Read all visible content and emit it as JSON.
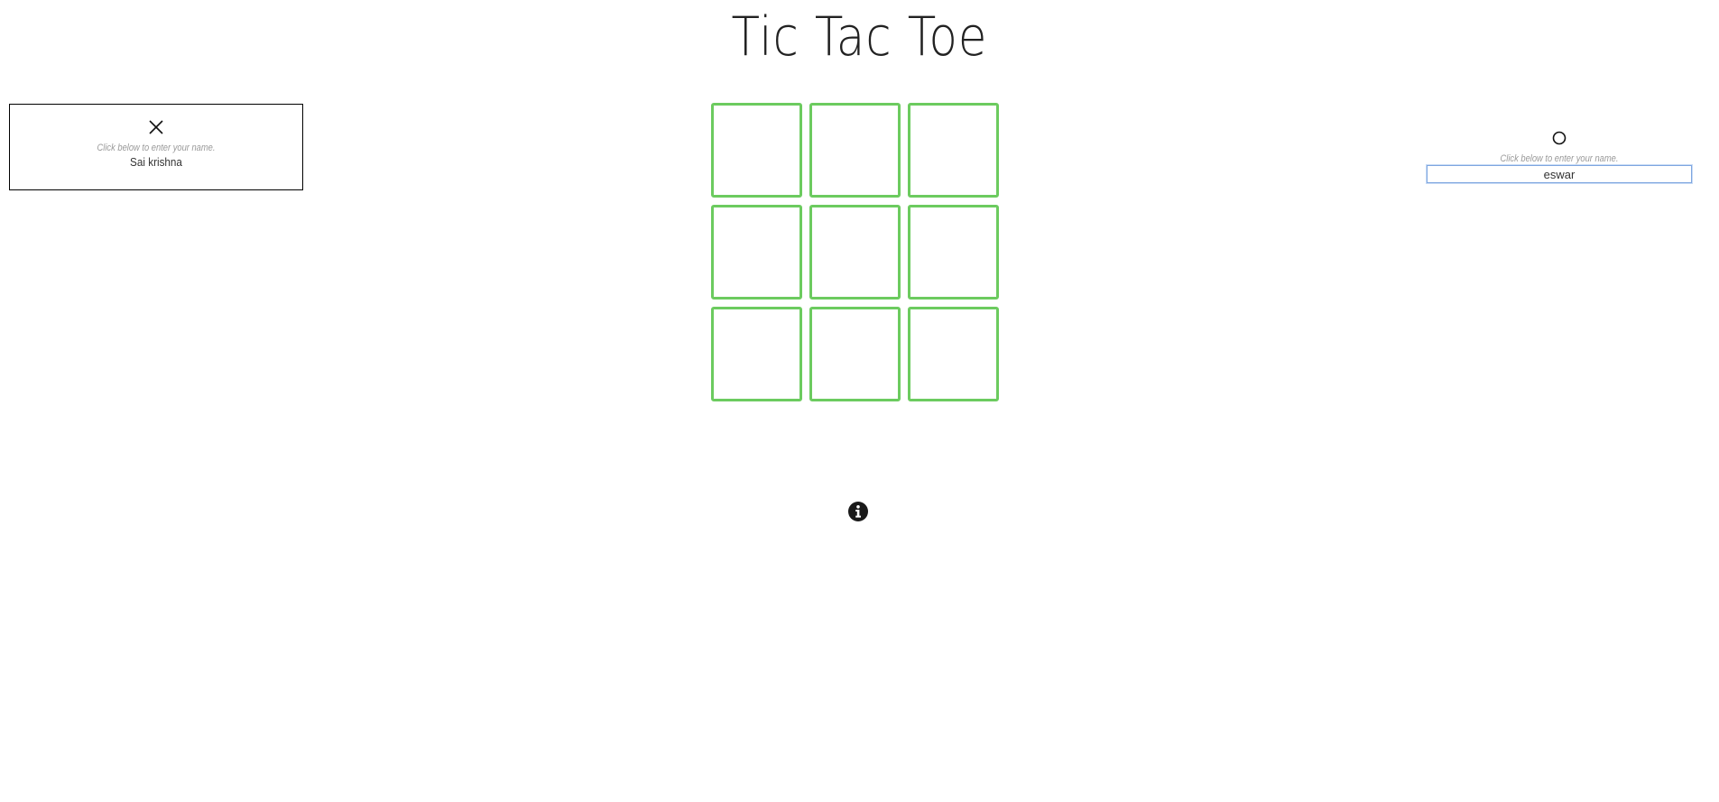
{
  "title": "Tic Tac Toe",
  "player_x": {
    "symbol": "X",
    "hint": "Click below to enter your name.",
    "name": "Sai krishna"
  },
  "player_o": {
    "symbol": "O",
    "hint": "Click below to enter your name.",
    "name": "eswar"
  },
  "board": {
    "cells": [
      "",
      "",
      "",
      "",
      "",
      "",
      "",
      "",
      ""
    ],
    "border_color": "#6ccb5f"
  },
  "icons": {
    "info": "info-icon",
    "x": "x-mark-icon",
    "o": "o-mark-icon"
  }
}
